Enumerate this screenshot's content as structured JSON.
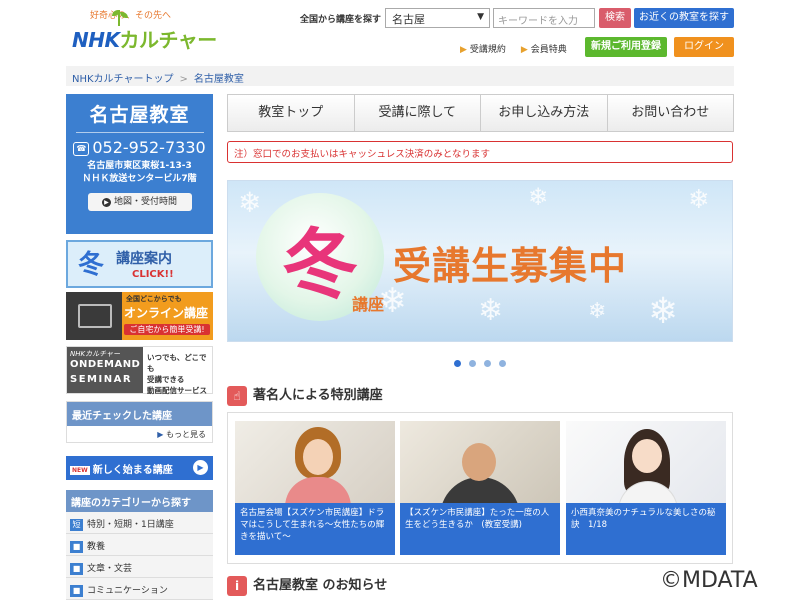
{
  "header": {
    "logo_tagline": "好奇心の、その先へ",
    "logo_nhk": "NHK",
    "logo_culture": "カルチャー",
    "search_label": "全国から講座を探す",
    "area_value": "名古屋",
    "keyword_placeholder": "キーワードを入力",
    "search_button": "検索",
    "near_button": "お近くの教室を探す",
    "links": [
      "受講規約",
      "会員特典"
    ],
    "register_button": "新規ご利用登録",
    "login_button": "ログイン"
  },
  "breadcrumb": {
    "home": "NHKカルチャートップ",
    "current": "名古屋教室"
  },
  "sidebar": {
    "class_name": "名古屋教室",
    "tel": "052-952-7330",
    "address_line1": "名古屋市東区東桜1-13-3",
    "address_line2": "ＮＨＫ放送センタービル7階",
    "map_button": "地図・受付時間",
    "banner_winter": {
      "big": "冬",
      "text": "講座案内",
      "click": "CLICK!!"
    },
    "banner_online": {
      "line1": "全国どこからでも",
      "title": "オンライン講座",
      "sub": "ご自宅から簡単受講!"
    },
    "banner_ondemand": {
      "brand": "NHKカルチャー",
      "title1": "ONDEMAND",
      "title2": "SEMINAR",
      "desc1": "いつでも、どこでも",
      "desc2": "受講できる",
      "desc3": "動画配信サービス"
    },
    "recent_title": "最近チェックした講座",
    "recent_more": "もっと見る",
    "new_course": "新しく始まる講座",
    "new_tag": "NEW",
    "category_title": "講座のカテゴリーから探す",
    "categories": [
      {
        "icon": "短",
        "label": "特別・短期・1日講座"
      },
      {
        "icon": "■",
        "label": "教養"
      },
      {
        "icon": "■",
        "label": "文章・文芸"
      },
      {
        "icon": "■",
        "label": "コミュニケーション"
      }
    ]
  },
  "nav": {
    "tabs": [
      "教室トップ",
      "受講に際して",
      "お申し込み方法",
      "お問い合わせ"
    ]
  },
  "notice": "注）窓口でのお支払いはキャッシュレス決済のみとなります",
  "hero": {
    "big": "冬",
    "koza": "講座",
    "text": "受講生募集中"
  },
  "slider": {
    "count": 4,
    "active": 1
  },
  "special": {
    "title": "著名人による特別講座",
    "cards": [
      {
        "caption": "名古屋会場【スズケン市民講座】ドラマはこうして生まれる～女性たちの輝きを描いて～"
      },
      {
        "caption": "【スズケン市民講座】たった一度の人生をどう生きるか　(教室受講)"
      },
      {
        "caption": "小西真奈美のナチュラルな美しさの秘訣　1/18"
      }
    ]
  },
  "news": {
    "title": "名古屋教室 のお知らせ"
  },
  "watermark": "©MDATA",
  "colors": {
    "brand_blue": "#2f6fd1",
    "notice_red": "#d93232",
    "register_green": "#5cb82e",
    "login_orange": "#f0911e"
  }
}
